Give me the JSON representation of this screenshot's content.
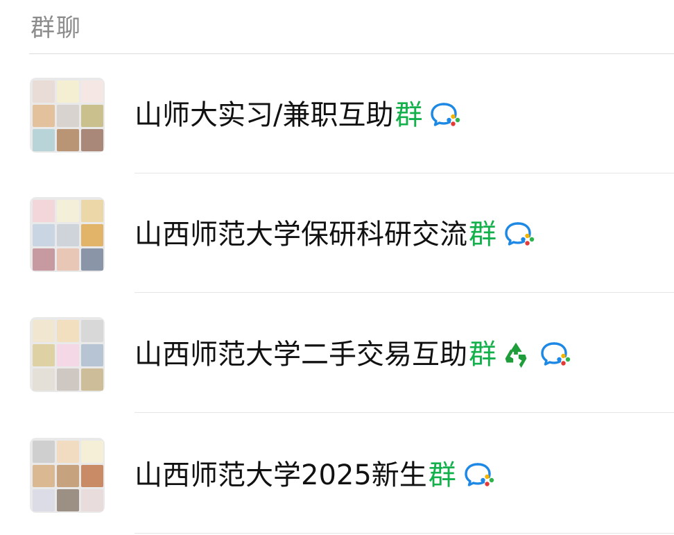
{
  "section": {
    "title": "群聊"
  },
  "groups": [
    {
      "name_main": "山师大实习/兼职互助",
      "name_suffix": "群",
      "has_recycle": false,
      "avatars": [
        "#e9dcd6",
        "#f4efd2",
        "#f5e8e4",
        "#e3c19d",
        "#d9d3cf",
        "#c9c08e",
        "#b8d4d8",
        "#b99475",
        "#a9887a"
      ]
    },
    {
      "name_main": "山西师范大学保研科研交流",
      "name_suffix": "群",
      "has_recycle": false,
      "avatars": [
        "#f3d6d9",
        "#f3efd8",
        "#ecd7a8",
        "#c9d5e3",
        "#cfd4da",
        "#e2b46a",
        "#c79aa2",
        "#e8c7b7",
        "#8a95a8"
      ]
    },
    {
      "name_main": "山西师范大学二手交易互助",
      "name_suffix": "群",
      "has_recycle": true,
      "avatars": [
        "#f1e6cf",
        "#f2dfc0",
        "#d8d8d8",
        "#ded2a5",
        "#f4d8e6",
        "#b7c4d3",
        "#e4e0d8",
        "#cfc7c2",
        "#cdbd98"
      ]
    },
    {
      "name_main": "山西师范大学2025新生",
      "name_suffix": "群",
      "has_recycle": false,
      "avatars": [
        "#cfcfcf",
        "#f1dcc1",
        "#f4efd6",
        "#d9b892",
        "#c6a37e",
        "#c98a66",
        "#dcdce6",
        "#9c9084",
        "#e8dcdc"
      ]
    }
  ],
  "icons": {
    "recycle": "recycle-icon",
    "wecom": "wecom-group-icon"
  },
  "colors": {
    "accent_green": "#13b04b",
    "recycle_green": "#1f9d3a"
  }
}
